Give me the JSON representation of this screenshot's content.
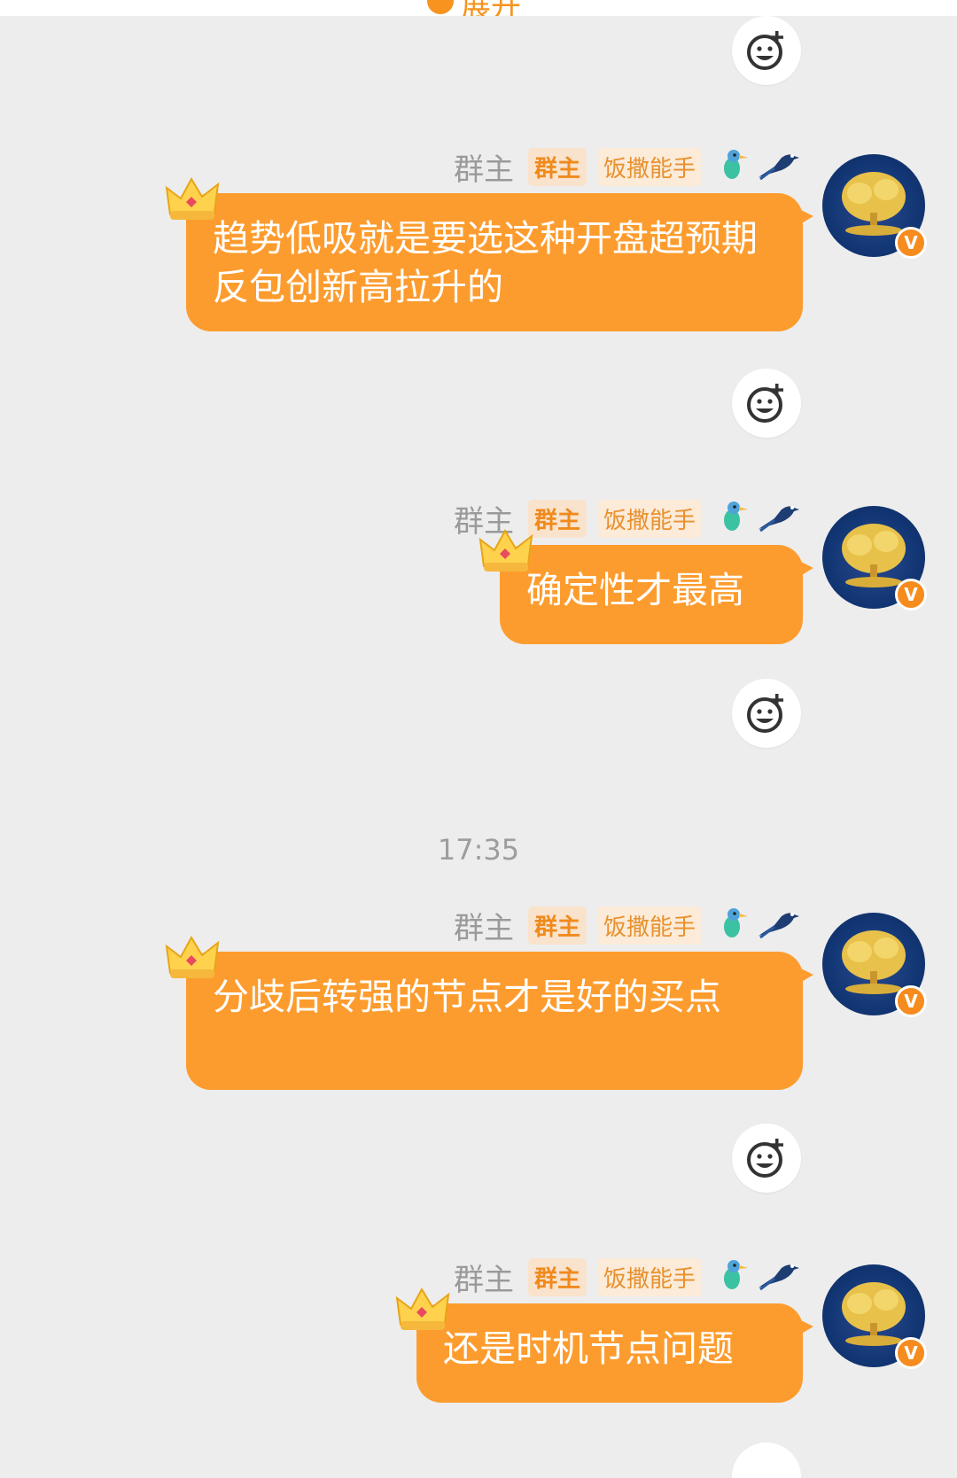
{
  "top": {
    "expand_label": "展开"
  },
  "messages": [
    {
      "sender": "群主",
      "role_badge": "群主",
      "title_badge": "饭撒能手",
      "text": "趋势低吸就是要选这种开盘超预期反包创新高拉升的"
    },
    {
      "sender": "群主",
      "role_badge": "群主",
      "title_badge": "饭撒能手",
      "text": "确定性才最高"
    },
    {
      "sender": "群主",
      "role_badge": "群主",
      "title_badge": "饭撒能手",
      "text": "分歧后转强的节点才是好的买点"
    },
    {
      "sender": "群主",
      "role_badge": "群主",
      "title_badge": "饭撒能手",
      "text": "还是时机节点问题"
    }
  ],
  "timestamp": "17:35",
  "icons": {
    "reaction": "add-reaction-icon",
    "crown": "crown-icon",
    "verified": "verified-v-icon",
    "bird_badges": [
      "kingfisher-badge-icon",
      "magpie-badge-icon"
    ]
  },
  "colors": {
    "bubble": "#fd9c2e",
    "background": "#ededed",
    "accent": "#f7931e"
  }
}
